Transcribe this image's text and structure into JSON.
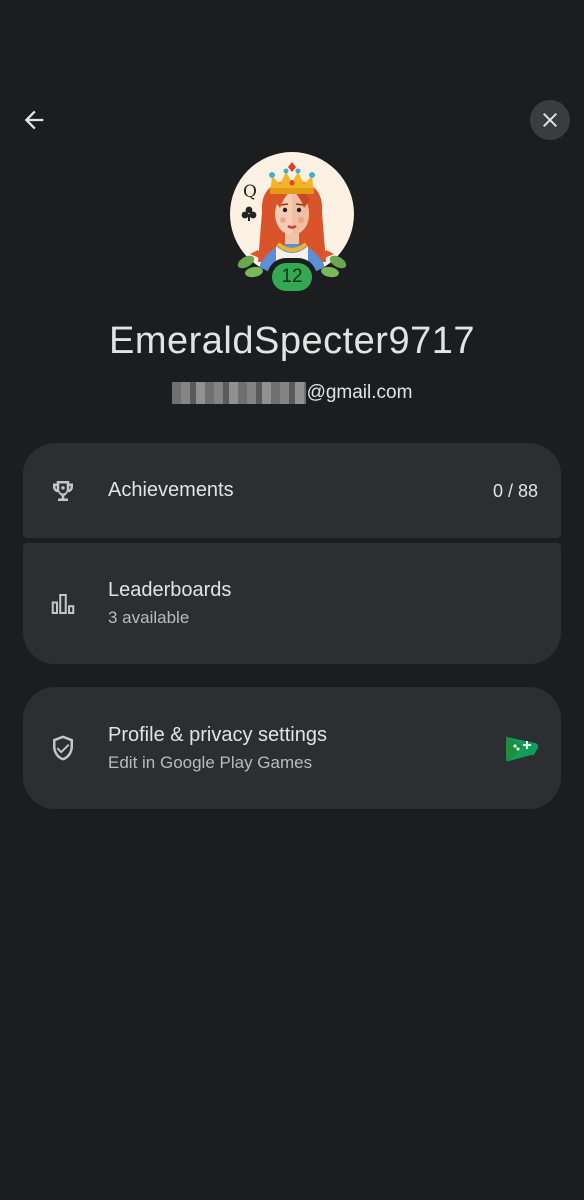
{
  "header": {
    "back_icon": "arrow-back-icon",
    "close_icon": "close-icon"
  },
  "profile": {
    "avatar_icon": "queen-of-clubs-avatar",
    "level": "12",
    "gamer_name": "EmeraldSpecter9717",
    "email_suffix": "@gmail.com"
  },
  "stats": {
    "achievements": {
      "icon": "trophy-icon",
      "label": "Achievements",
      "count": "0 / 88"
    },
    "leaderboards": {
      "icon": "leaderboard-icon",
      "label": "Leaderboards",
      "subtitle": "3 available"
    }
  },
  "settings": {
    "icon": "shield-check-icon",
    "label": "Profile & privacy settings",
    "subtitle": "Edit in Google Play Games",
    "trailing_icon": "play-games-icon"
  },
  "colors": {
    "background": "#1b1d1e",
    "card": "#2c2f31",
    "level_badge": "#34a853"
  }
}
